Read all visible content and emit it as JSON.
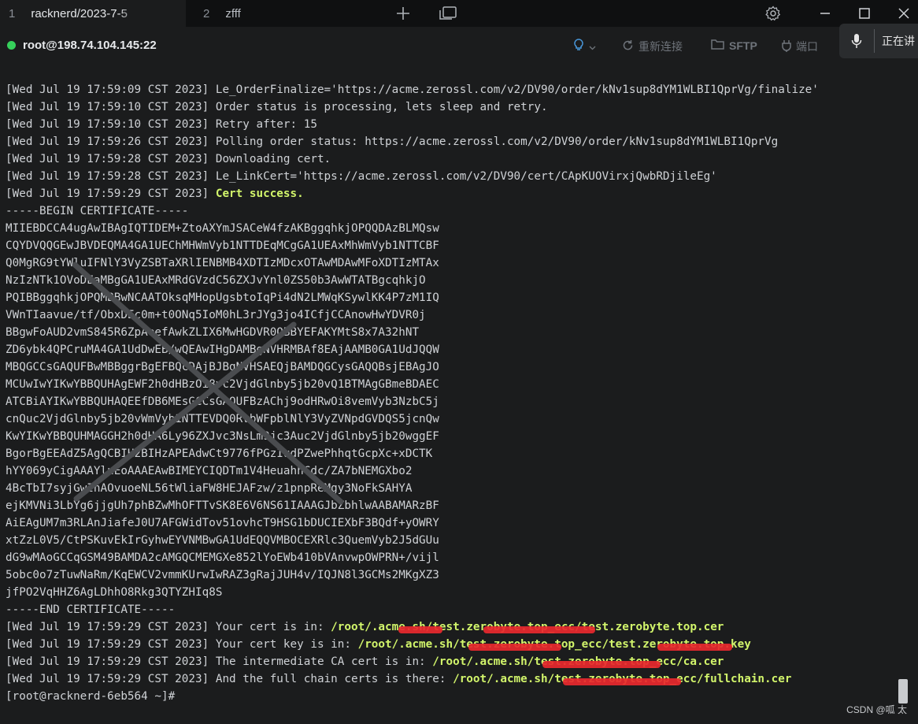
{
  "tabs": [
    {
      "num": "1",
      "title": "racknerd/2023-7-5"
    },
    {
      "num": "2",
      "title": "zfff"
    }
  ],
  "connection": {
    "host": "root@198.74.104.145:22",
    "reconnect_label": "重新连接",
    "sftp_label": "SFTP",
    "port_label": "端口",
    "status_color": "#36d05b"
  },
  "voice_popup": {
    "text": "正在讲"
  },
  "terminal": {
    "lines": [
      "[Wed Jul 19 17:59:09 CST 2023] Le_OrderFinalize='https://acme.zerossl.com/v2/DV90/order/kNv1sup8dYM1WLBI1QprVg/finalize'",
      "[Wed Jul 19 17:59:10 CST 2023] Order status is processing, lets sleep and retry.",
      "[Wed Jul 19 17:59:10 CST 2023] Retry after: 15",
      "[Wed Jul 19 17:59:26 CST 2023] Polling order status: https://acme.zerossl.com/v2/DV90/order/kNv1sup8dYM1WLBI1QprVg",
      "[Wed Jul 19 17:59:28 CST 2023] Downloading cert.",
      "[Wed Jul 19 17:59:28 CST 2023] Le_LinkCert='https://acme.zerossl.com/v2/DV90/cert/CApKUOVirxjQwbRDjileEg'"
    ],
    "success_prefix": "[Wed Jul 19 17:59:29 CST 2023] ",
    "success_text": "Cert success.",
    "cert_begin": "-----BEGIN CERTIFICATE-----",
    "cert_lines": [
      "MIIEBDCCA4ugAwIBAgIQTIDEM+ZtoAXYmJSACeW4fzAKBggqhkjOPQQDAzBLMQsw",
      "CQYDVQQGEwJBVDEQMA4GA1UEChMHWmVyb1NTTDEqMCgGA1UEAxMhWmVyb1NTTCBF",
      "Q0MgRG9tYWluIFNlY3VyZSBTaXRlIENBMB4XDTIzMDcxOTAwMDAwMFoXDTIzMTAx",
      "NzIzNTk1OVoDEaMBgGA1UEAxMRdGVzdC56ZXJvYnl0ZS50b3AwWTATBgcqhkjO",
      "PQIBBggqhkjOPQMBBwNCAATOksqMHopUgsbtoIqPi4dN2LMWqKSywlKK4P7zM1IQ",
      "VWnTIaavue/tf/ObxDEc0m+t0ONq5IoM0hL3rJYg3jo4ICfjCCAnowHwYDVR0j",
      "BBgwFoAUD2vmS845R6ZpAeefAwkZLIX6MwHGDVR0OBBYEFAKYMtS8x7A32hNT",
      "ZD6ybk4QPCruMA4GA1UdDwEB/wQEAwIHgDAMBgNVHRMBAf8EAjAAMB0GA1UdJQQW",
      "MBQGCCsGAQUFBwMBBggrBgEFBQcDAjBJBgNVHSAEQjBAMDQGCysGAQQBsjEBAgJO",
      "MCUwIwYIKwYBBQUHAgEWF2h0dHBzOi8vc2VjdGlnby5jb20vQ1BTMAgGBmeBDAEC",
      "ATCBiAYIKwYBBQUHAQEEfDB6MEsGCCsGAQUFBzAChj9odHRwOi8vemVyb3NzbC5j",
      "cnQuc2VjdGlnby5jb20vWmVyb1NTTEVDQ0RvbWFpblNlY3VyZVNpdGVDQS5jcnQw",
      "KwYIKwYBBQUHMAGGH2h0dHA6Ly96ZXJvc3NsLm9jc3Auc2VjdGlnby5jb20wggEF",
      "BgorBgEEAdZ5AgQCBIH2BIHzAPEAdwCt9776fPGzIudPZwePhhqtGcpXc+xDCTK",
      "hYY069yCigAAAYluEoAAAEAwBIMEYCIQDTm1V4HeuahhCdc/ZA7bNEMGXbo2",
      "4BcTbI7syjGwIhAOvuoeNL56tWliaFW8HEJAFzw/z1pnpReMgy3NoFkSAHYA",
      "ejKMVNi3LbYg6jjgUh7phBZwMhOFTTvSK8E6V6NS61IAAAGJbZbhlwAABAMARzBF",
      "AiEAgUM7m3RLAnJiafeJ0U7AFGWidTov51ovhcT9HSG1bDUCIEXbF3BQdf+yOWRY",
      "xtZzL0V5/CtPSKuvEkIrGyhwEYVNMBwGA1UdEQQVMBOCEXRlc3QuemVyb2J5dGUu",
      "dG9wMAoGCCqGSM49BAMDA2cAMGQCMEMGXe852lYoEWb410bVAnvwpOWPRN+/vijl",
      "5obc0o7zTuwNaRm/KqEWCV2vmmKUrwIwRAZ3gRajJUH4v/IQJN8l3GCMs2MKgXZ3",
      "jfPO2VqHHZ6AgLDhhO8Rkg3QTYZHIq8S"
    ],
    "cert_end": "-----END CERTIFICATE-----",
    "result_lines": [
      {
        "prefix": "[Wed Jul 19 17:59:29 CST 2023] Your cert is in: ",
        "path": "/root/.acme.sh/test.zerobyte.top_ecc/test.zerobyte.top.cer"
      },
      {
        "prefix": "[Wed Jul 19 17:59:29 CST 2023] Your cert key is in: ",
        "path": "/root/.acme.sh/test.zerobyte.top_ecc/test.zerobyte.top.key"
      },
      {
        "prefix": "[Wed Jul 19 17:59:29 CST 2023] The intermediate CA cert is in: ",
        "path": "/root/.acme.sh/test.zerobyte.top_ecc/ca.cer"
      },
      {
        "prefix": "[Wed Jul 19 17:59:29 CST 2023] And the full chain certs is there: ",
        "path": "/root/.acme.sh/test.zerobyte.top_ecc/fullchain.cer"
      }
    ],
    "prompt": "[root@racknerd-6eb564 ~]#"
  },
  "watermark": "CSDN @呱 太",
  "colors": {
    "highlight": "#d2f56b",
    "redaction": "#e8282e",
    "background": "#1b1c1d"
  }
}
